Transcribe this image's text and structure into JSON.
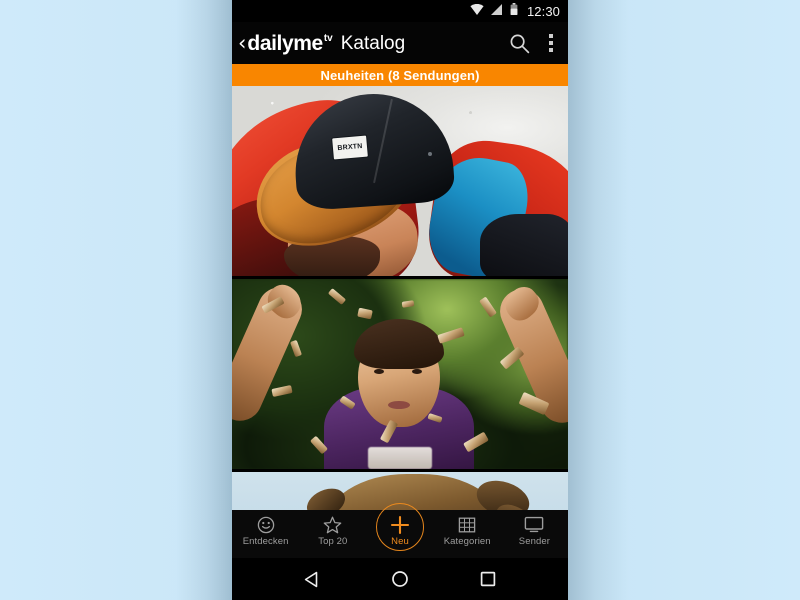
{
  "page": {
    "background_color": "#cde8f8",
    "device_frame": "android-phone-screenshot"
  },
  "statusbar": {
    "time": "12:30",
    "icons": [
      "wifi-icon",
      "signal-icon",
      "battery-icon"
    ]
  },
  "appbar": {
    "back_label": "‹",
    "brand_name": "dailyme",
    "brand_superscript": "tv",
    "screen_title": "Katalog",
    "search_icon": "search-icon",
    "overflow_icon": "overflow-menu-icon",
    "background_color": "#050505"
  },
  "banner": {
    "text": "Neuheiten (8 Sendungen)",
    "color": "#f98600",
    "text_color": "#ffffff"
  },
  "feed": {
    "items": [
      {
        "id": "card-snowboarder",
        "alt": "Person mit schwarzer Cap und rot-blauer Jacke im Schnee",
        "cap_label": "BRXTN"
      },
      {
        "id": "card-forest",
        "alt": "Person im lila Shirt mit erhobenen Armen und fliegenden Holzspaenen"
      },
      {
        "id": "card-hair-sky",
        "alt": "Angeschnittener Kopf mit zerzaustem Haar vor hellblauem Himmel"
      }
    ]
  },
  "tabbar": {
    "active_color": "#f08c1e",
    "inactive_color": "#9d9d9d",
    "items": [
      {
        "label": "Entdecken",
        "icon": "smiley-icon",
        "active": false
      },
      {
        "label": "Top 20",
        "icon": "star-icon",
        "active": false
      },
      {
        "label": "Neu",
        "icon": "plus-icon",
        "active": true
      },
      {
        "label": "Kategorien",
        "icon": "grid-icon",
        "active": false
      },
      {
        "label": "Sender",
        "icon": "monitor-icon",
        "active": false
      }
    ]
  },
  "androidnav": {
    "buttons": [
      {
        "name": "back",
        "icon": "triangle-back-icon"
      },
      {
        "name": "home",
        "icon": "circle-home-icon"
      },
      {
        "name": "recents",
        "icon": "square-recents-icon"
      }
    ]
  }
}
